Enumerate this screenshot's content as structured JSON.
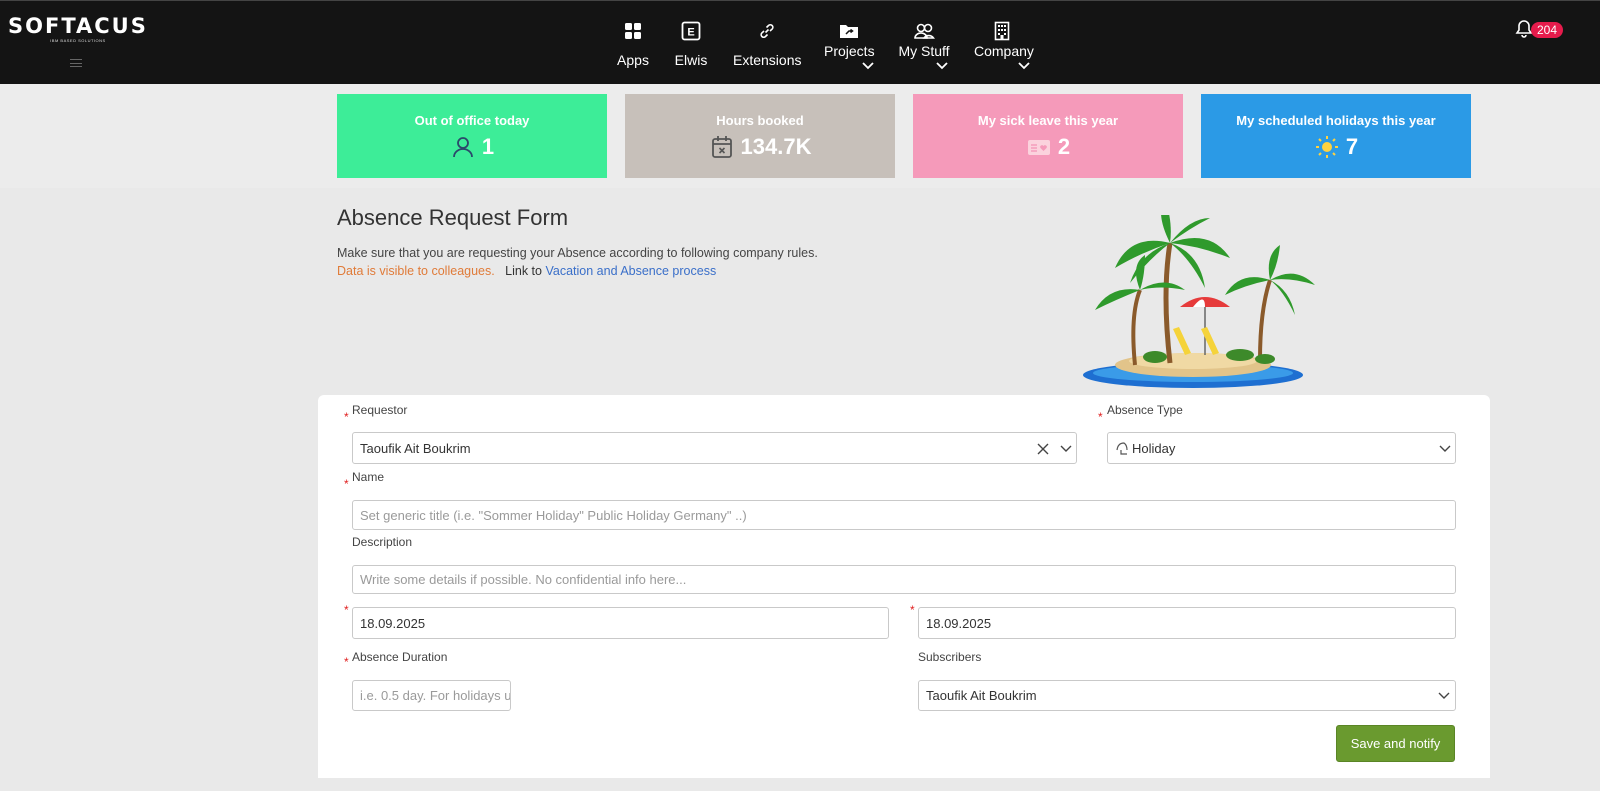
{
  "brand": {
    "logo": "SOFTACUS",
    "tagline": "IBM BASED SOLUTIONS"
  },
  "nav": [
    {
      "label": "Apps",
      "icon": "apps-grid-icon"
    },
    {
      "label": "Elwis",
      "icon": "elwis-e-icon"
    },
    {
      "label": "Extensions",
      "icon": "link-icon"
    },
    {
      "label": "Projects",
      "icon": "folder-icon"
    },
    {
      "label": "My Stuff",
      "icon": "users-icon"
    },
    {
      "label": "Company",
      "icon": "building-icon"
    }
  ],
  "notifications": {
    "count": "204"
  },
  "stats": [
    {
      "title": "Out of office today",
      "value": "1",
      "color": "#3ded98",
      "icon": "person-icon"
    },
    {
      "title": "Hours booked",
      "value": "134.7K",
      "color": "#c7c0ba",
      "icon": "calendar-x-icon"
    },
    {
      "title": "My sick leave this year",
      "value": "2",
      "color": "#f59aba",
      "icon": "sick-note-icon"
    },
    {
      "title": "My scheduled holidays this year",
      "value": "7",
      "color": "#2b9ae6",
      "icon": "sun-icon"
    }
  ],
  "form": {
    "title": "Absence Request Form",
    "description": "Make sure that you are requesting your Absence according to following company rules.",
    "visibility_note": "Data is visible to colleagues.",
    "link_prefix": "Link to",
    "link_text": "Vacation and Absence process",
    "requestor": {
      "label": "Requestor",
      "value": "Taoufik Ait Boukrim"
    },
    "absence_type": {
      "label": "Absence Type",
      "value": "Holiday"
    },
    "name": {
      "label": "Name",
      "placeholder": "Set generic title (i.e. \"Sommer Holiday\" Public Holiday Germany\" ..)"
    },
    "description_field": {
      "label": "Description",
      "placeholder": "Write some details if possible. No confidential info here..."
    },
    "start_date": "18.09.2025",
    "end_date": "18.09.2025",
    "duration": {
      "label": "Absence Duration",
      "placeholder": "i.e. 0.5 day. For holidays u"
    },
    "subscribers": {
      "label": "Subscribers",
      "value": "Taoufik Ait Boukrim"
    },
    "save_label": "Save and notify"
  }
}
